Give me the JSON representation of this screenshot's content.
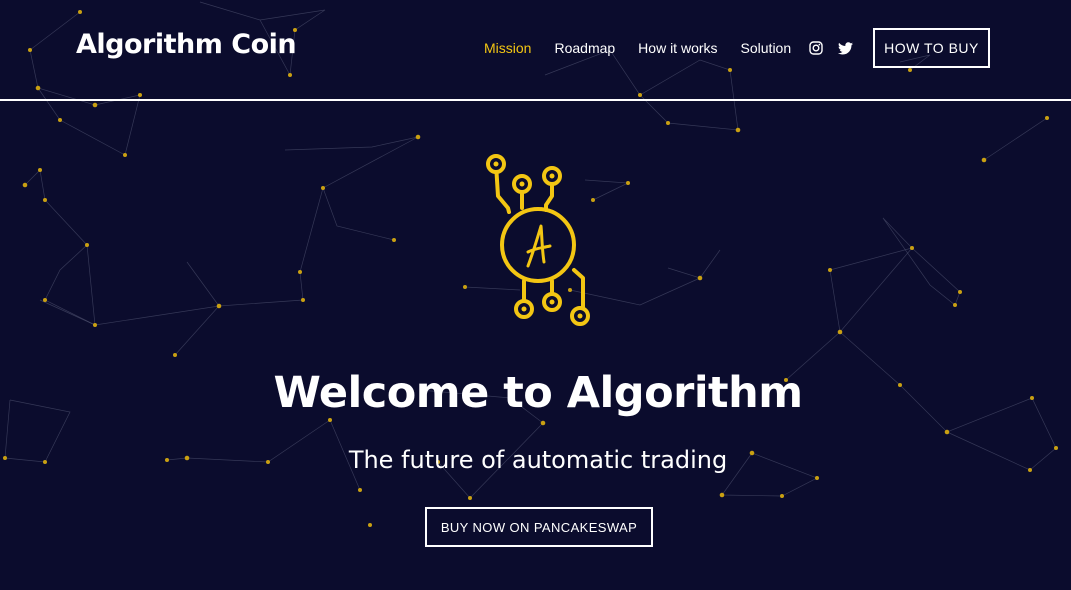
{
  "brand": {
    "name": "Algorithm Coin"
  },
  "nav": {
    "items": [
      {
        "label": "Mission",
        "active": true
      },
      {
        "label": "Roadmap",
        "active": false
      },
      {
        "label": "How it works",
        "active": false
      },
      {
        "label": "Solution",
        "active": false
      }
    ],
    "social": [
      "instagram-icon",
      "twitter-icon"
    ],
    "cta_label": "HOW TO BUY"
  },
  "hero": {
    "emblem_letter": "A",
    "title": "Welcome to Algorithm",
    "subtitle": "The future of automatic trading",
    "cta_label": "BUY NOW ON PANCAKESWAP"
  },
  "colors": {
    "background": "#0b0c2d",
    "accent": "#f3c613",
    "text": "#ffffff"
  }
}
